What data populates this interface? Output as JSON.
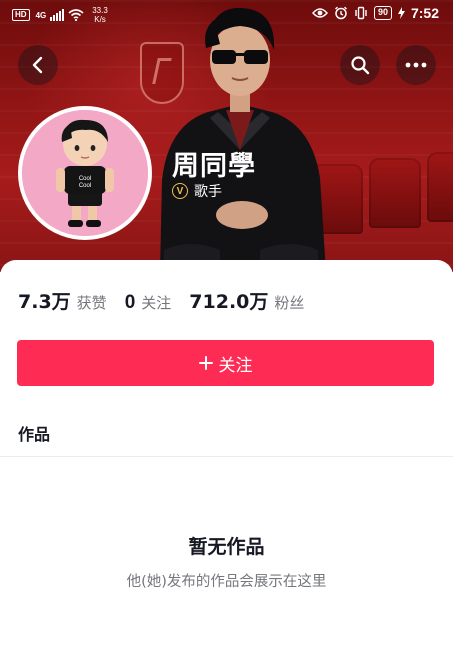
{
  "status_bar": {
    "hd_label": "HD",
    "network_label": "4G",
    "speed_value": "33.3",
    "speed_unit": "K/s",
    "battery_level": "90",
    "time": "7:52"
  },
  "header": {
    "back_icon": "chevron-left-icon",
    "search_icon": "search-icon",
    "more_icon": "more-horizontal-icon"
  },
  "profile": {
    "display_name": "周同學",
    "verified_badge_letter": "V",
    "verified_label": "歌手",
    "stats": [
      {
        "value": "7.3万",
        "label": "获赞"
      },
      {
        "value": "0",
        "label": "关注"
      },
      {
        "value": "712.0万",
        "label": "粉丝"
      }
    ]
  },
  "actions": {
    "follow_label": "关注",
    "follow_icon": "plus-icon"
  },
  "content": {
    "works_tab_label": "作品",
    "empty_title": "暂无作品",
    "empty_subtitle": "他(她)发布的作品会展示在这里"
  },
  "colors": {
    "accent": "#fe2c55",
    "banner": "#9a1818",
    "verified": "#f2c14e",
    "secondary_text": "#75777d"
  }
}
